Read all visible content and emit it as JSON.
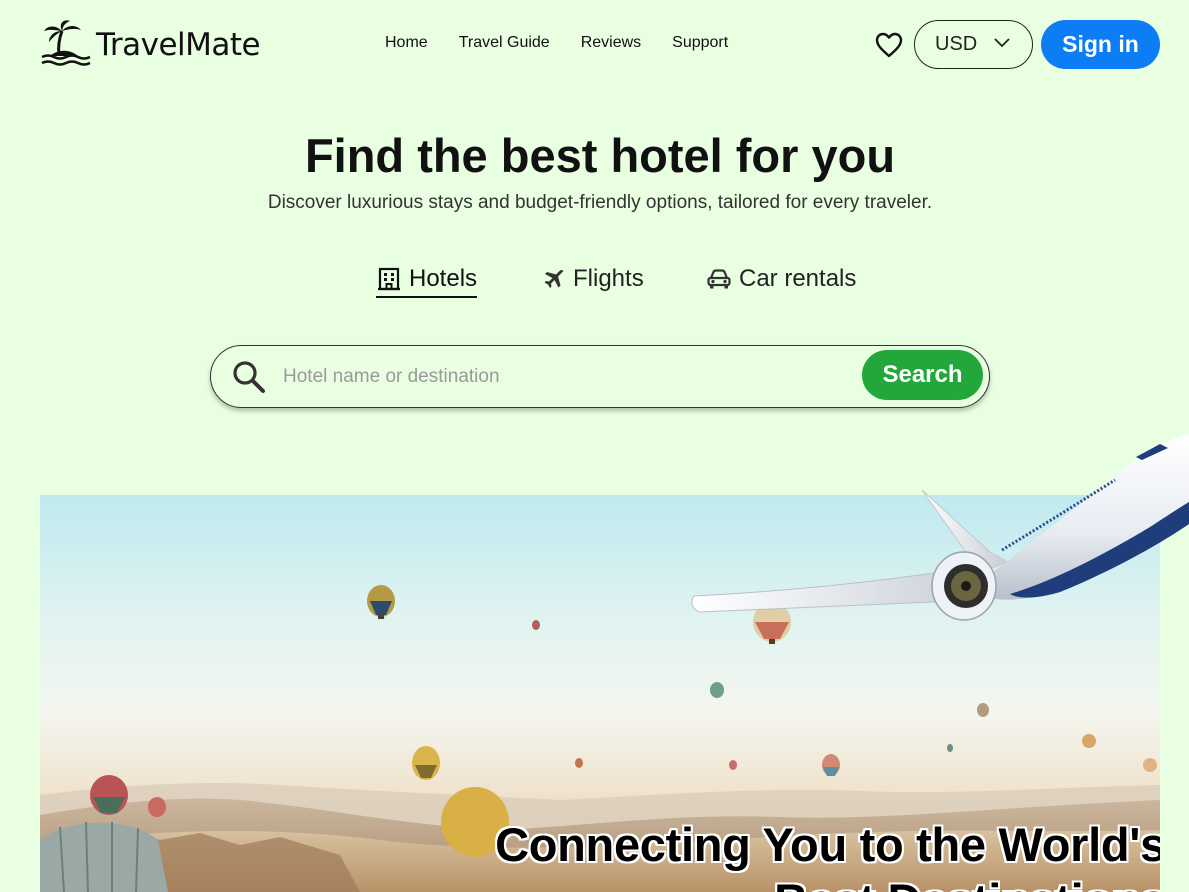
{
  "brand": {
    "name": "TravelMate",
    "logo_icon": "palm-island-icon"
  },
  "nav": {
    "items": [
      {
        "label": "Home"
      },
      {
        "label": "Travel Guide"
      },
      {
        "label": "Reviews"
      },
      {
        "label": "Support"
      }
    ]
  },
  "header": {
    "favorites_icon": "heart-icon",
    "currency": "USD",
    "signin_label": "Sign in"
  },
  "hero": {
    "title": "Find the best hotel for you",
    "subtitle": "Discover luxurious stays and budget-friendly options, tailored for every traveler."
  },
  "tabs": [
    {
      "label": "Hotels",
      "icon": "hotel-icon",
      "active": true
    },
    {
      "label": "Flights",
      "icon": "airplane-icon",
      "active": false
    },
    {
      "label": "Car rentals",
      "icon": "car-icon",
      "active": false
    }
  ],
  "search": {
    "placeholder": "Hotel name or destination",
    "value": "",
    "button_label": "Search"
  },
  "banner": {
    "caption_line1": "Connecting You to the World's",
    "caption_line2": "Best Destinations"
  },
  "colors": {
    "background": "#e9ffe1",
    "primary_blue": "#0d7df6",
    "search_green": "#22a83a"
  }
}
